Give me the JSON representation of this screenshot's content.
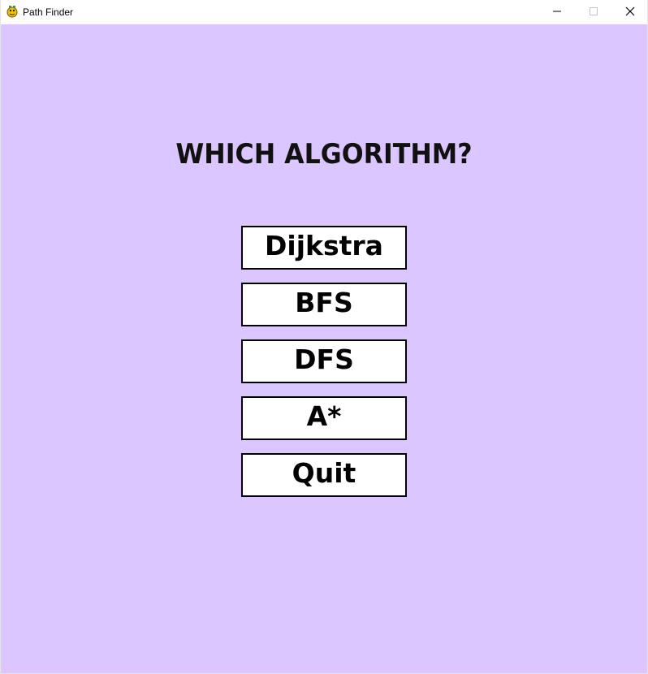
{
  "window": {
    "title": "Path Finder"
  },
  "menu": {
    "heading": "WHICH ALGORITHM?",
    "buttons": [
      {
        "label": "Dijkstra"
      },
      {
        "label": "BFS"
      },
      {
        "label": "DFS"
      },
      {
        "label": "A*"
      },
      {
        "label": "Quit"
      }
    ]
  },
  "colors": {
    "background": "#dcc6ff",
    "button_fill": "#ffffff",
    "button_border": "#000000",
    "text": "#000000"
  },
  "icons": {
    "app": "pygame-snake-icon",
    "minimize": "minimize-icon",
    "maximize": "maximize-icon",
    "close": "close-icon"
  }
}
